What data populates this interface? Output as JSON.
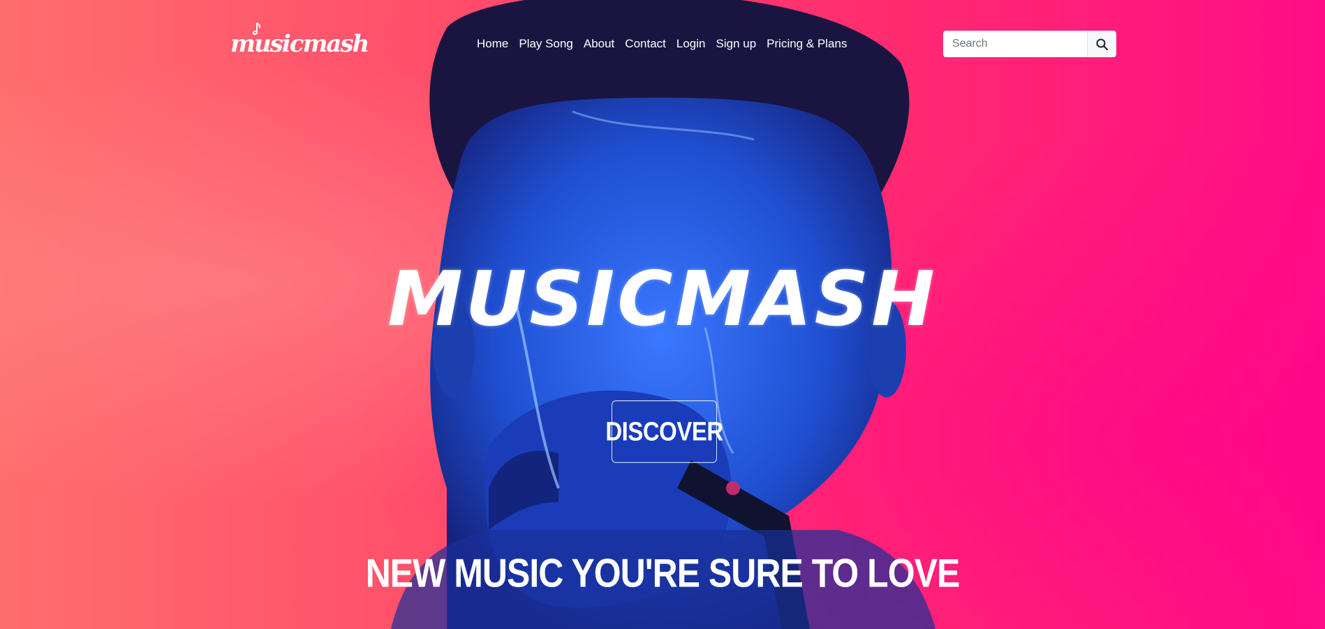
{
  "brand": {
    "logo_text": "musicmash"
  },
  "nav": {
    "links": [
      "Home",
      "Play Song",
      "About",
      "Contact",
      "Login",
      "Sign up",
      "Pricing & Plans"
    ]
  },
  "search": {
    "placeholder": "Search",
    "button_icon": "search-icon"
  },
  "hero": {
    "title": "MUSICMASH",
    "cta_label": "DISCOVER",
    "tagline": "NEW MUSIC YOU'RE SURE TO LOVE"
  },
  "colors": {
    "background_left": "#ff6e6e",
    "background_right": "#ff0d86",
    "figure_blue": "#1f4fd1",
    "text": "#ffffff"
  }
}
